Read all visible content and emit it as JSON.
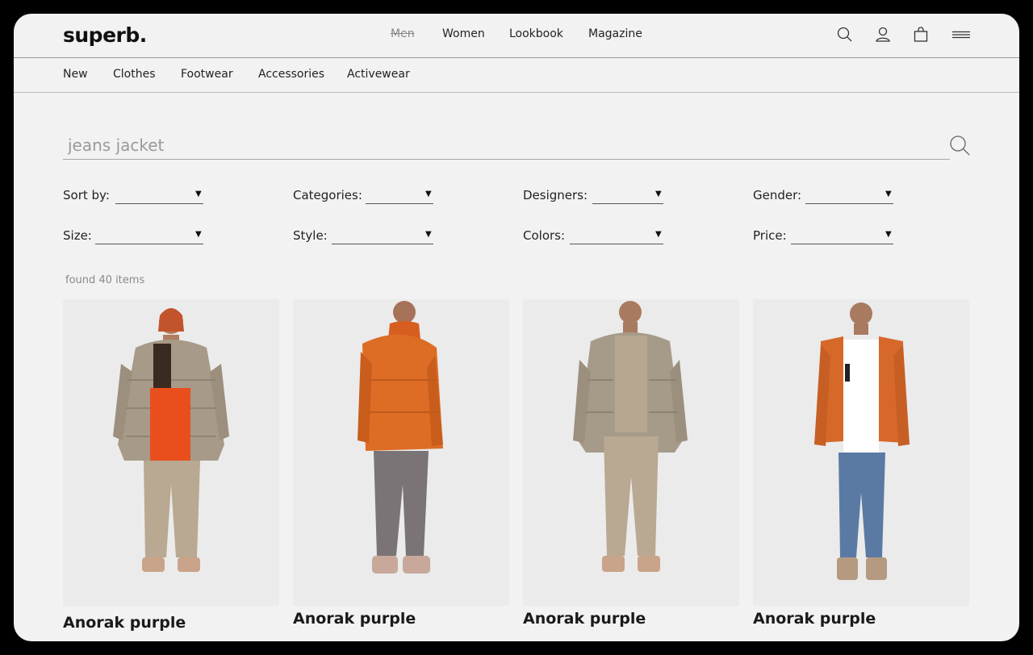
{
  "brand": {
    "logo": "superb."
  },
  "topnav": [
    "Men",
    "Women",
    "Lookbook",
    "Magazine"
  ],
  "header_icons": [
    "search-icon",
    "user-icon",
    "bag-icon",
    "menu-icon"
  ],
  "subnav": [
    "New",
    "Clothes",
    "Footwear",
    "Accessories",
    "Activewear"
  ],
  "search": {
    "value": "jeans jacket"
  },
  "filters": [
    {
      "label": "Sort by:"
    },
    {
      "label": "Categories:"
    },
    {
      "label": "Designers:"
    },
    {
      "label": "Gender:"
    },
    {
      "label": "Size:"
    },
    {
      "label": "Style:"
    },
    {
      "label": "Colors:"
    },
    {
      "label": "Price:"
    }
  ],
  "results": {
    "found_text": "found 40 items"
  },
  "products": [
    {
      "name": "Anorak purple"
    },
    {
      "name": "Anorak purple"
    },
    {
      "name": "Anorak purple"
    },
    {
      "name": "Anorak purple"
    }
  ],
  "colors": {
    "background": "#f2f2f2",
    "text": "#222222",
    "muted": "#8a8a8a",
    "orange": "#e0671f"
  }
}
